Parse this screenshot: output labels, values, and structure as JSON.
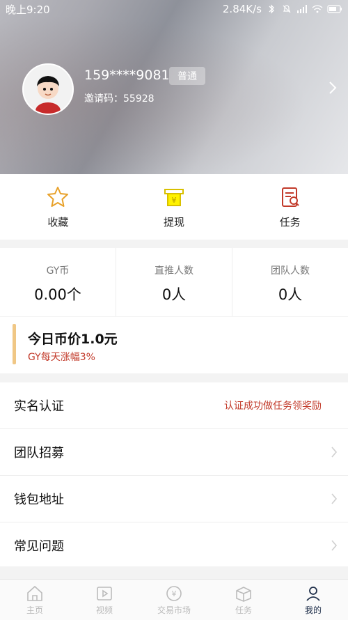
{
  "status_bar": {
    "time": "晚上9:20",
    "speed": "2.84K/s"
  },
  "profile": {
    "phone": "159****9081",
    "badge": "普通",
    "invite_label": "邀请码：",
    "invite_code": "55928"
  },
  "quick_actions": [
    {
      "label": "收藏",
      "icon": "star-icon"
    },
    {
      "label": "提现",
      "icon": "withdraw-icon"
    },
    {
      "label": "任务",
      "icon": "task-icon"
    }
  ],
  "stats": [
    {
      "title": "GY币",
      "value": "0.00个"
    },
    {
      "title": "直推人数",
      "value": "0人"
    },
    {
      "title": "团队人数",
      "value": "0人"
    }
  ],
  "price_card": {
    "title": "今日币价1.0元",
    "subtitle": "GY每天涨幅3%"
  },
  "menu": [
    {
      "label": "实名认证",
      "note": "认证成功做任务领奖励"
    },
    {
      "label": "团队招募",
      "note": ""
    },
    {
      "label": "钱包地址",
      "note": ""
    },
    {
      "label": "常见问题",
      "note": ""
    }
  ],
  "bottom_nav": [
    {
      "label": "主页",
      "icon": "home-icon"
    },
    {
      "label": "视频",
      "icon": "video-icon"
    },
    {
      "label": "交易市场",
      "icon": "market-icon"
    },
    {
      "label": "任务",
      "icon": "task-box-icon"
    },
    {
      "label": "我的",
      "icon": "profile-icon",
      "active": true
    }
  ],
  "colors": {
    "accent_red": "#c23a2a",
    "accent_gold": "#f0c785",
    "nav_active": "#1f2f4a"
  }
}
